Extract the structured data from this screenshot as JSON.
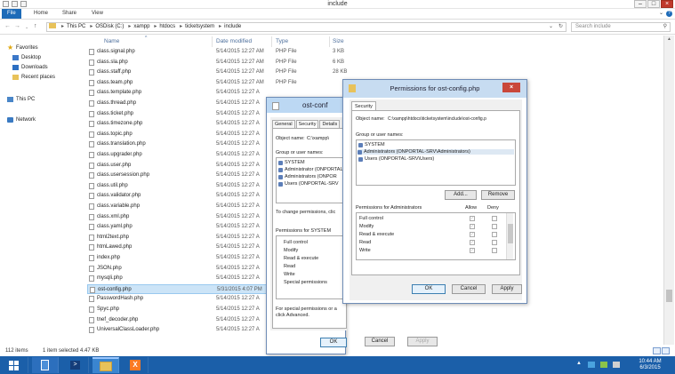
{
  "window": {
    "title": "include"
  },
  "ribbon": {
    "tabs": [
      "File",
      "Home",
      "Share",
      "View"
    ]
  },
  "address": {
    "crumbs": [
      "This PC",
      "OSDisk (C:)",
      "xampp",
      "htdocs",
      "ticketsystem",
      "include"
    ],
    "search_placeholder": "Search include"
  },
  "nav": {
    "favorites": "Favorites",
    "items": [
      "Desktop",
      "Downloads",
      "Recent places"
    ],
    "this_pc": "This PC",
    "network": "Network"
  },
  "columns": {
    "name": "Name",
    "date": "Date modified",
    "type": "Type",
    "size": "Size"
  },
  "files": [
    {
      "name": "class.signal.php",
      "date": "5/14/2015 12:27 AM",
      "type": "PHP File",
      "size": "3 KB"
    },
    {
      "name": "class.sla.php",
      "date": "5/14/2015 12:27 AM",
      "type": "PHP File",
      "size": "6 KB"
    },
    {
      "name": "class.staff.php",
      "date": "5/14/2015 12:27 AM",
      "type": "PHP File",
      "size": "28 KB"
    },
    {
      "name": "class.team.php",
      "date": "5/14/2015 12:27 AM",
      "type": "PHP File",
      "size": ""
    },
    {
      "name": "class.template.php",
      "date": "5/14/2015 12:27 A",
      "type": "",
      "size": ""
    },
    {
      "name": "class.thread.php",
      "date": "5/14/2015 12:27 A",
      "type": "",
      "size": ""
    },
    {
      "name": "class.ticket.php",
      "date": "5/14/2015 12:27 A",
      "type": "",
      "size": ""
    },
    {
      "name": "class.timezone.php",
      "date": "5/14/2015 12:27 A",
      "type": "",
      "size": ""
    },
    {
      "name": "class.topic.php",
      "date": "5/14/2015 12:27 A",
      "type": "",
      "size": ""
    },
    {
      "name": "class.translation.php",
      "date": "5/14/2015 12:27 A",
      "type": "",
      "size": ""
    },
    {
      "name": "class.upgrader.php",
      "date": "5/14/2015 12:27 A",
      "type": "",
      "size": ""
    },
    {
      "name": "class.user.php",
      "date": "5/14/2015 12:27 A",
      "type": "",
      "size": ""
    },
    {
      "name": "class.usersession.php",
      "date": "5/14/2015 12:27 A",
      "type": "",
      "size": ""
    },
    {
      "name": "class.util.php",
      "date": "5/14/2015 12:27 A",
      "type": "",
      "size": ""
    },
    {
      "name": "class.validator.php",
      "date": "5/14/2015 12:27 A",
      "type": "",
      "size": ""
    },
    {
      "name": "class.variable.php",
      "date": "5/14/2015 12:27 A",
      "type": "",
      "size": ""
    },
    {
      "name": "class.xml.php",
      "date": "5/14/2015 12:27 A",
      "type": "",
      "size": ""
    },
    {
      "name": "class.yaml.php",
      "date": "5/14/2015 12:27 A",
      "type": "",
      "size": ""
    },
    {
      "name": "html2text.php",
      "date": "5/14/2015 12:27 A",
      "type": "",
      "size": ""
    },
    {
      "name": "htmLawed.php",
      "date": "5/14/2015 12:27 A",
      "type": "",
      "size": ""
    },
    {
      "name": "index.php",
      "date": "5/14/2015 12:27 A",
      "type": "",
      "size": ""
    },
    {
      "name": "JSON.php",
      "date": "5/14/2015 12:27 A",
      "type": "",
      "size": ""
    },
    {
      "name": "mysqli.php",
      "date": "5/14/2015 12:27 A",
      "type": "",
      "size": ""
    },
    {
      "name": "ost-config.php",
      "date": "5/31/2015 4:07 PM",
      "type": "",
      "size": ""
    },
    {
      "name": "PasswordHash.php",
      "date": "5/14/2015 12:27 A",
      "type": "",
      "size": ""
    },
    {
      "name": "Spyc.php",
      "date": "5/14/2015 12:27 A",
      "type": "",
      "size": ""
    },
    {
      "name": "tnef_decoder.php",
      "date": "5/14/2015 12:27 A",
      "type": "",
      "size": ""
    },
    {
      "name": "UniversalClassLoader.php",
      "date": "5/14/2015 12:27 A",
      "type": "",
      "size": ""
    }
  ],
  "status": {
    "count": "112 items",
    "selected": "1 item selected  4.47 KB"
  },
  "props": {
    "title": "ost-conf",
    "tabs": [
      "General",
      "Security",
      "Details"
    ],
    "object_label": "Object name:",
    "object_value": "C:\\xampp\\",
    "group_label": "Group or user names:",
    "users": [
      "SYSTEM",
      "Administrator (ONPORTAL",
      "Administrators (ONPOR",
      "Users (ONPORTAL-SRV"
    ],
    "change_text": "To change permissions, clic",
    "perm_header": "Permissions for SYSTEM",
    "perms": [
      "Full control",
      "Modify",
      "Read & execute",
      "Read",
      "Write",
      "Special permissions"
    ],
    "special_text": "For special permissions or a",
    "special_text2": "click Advanced.",
    "ok": "OK",
    "cancel": "Cancel",
    "apply": "Apply"
  },
  "perm_dialog": {
    "title": "Permissions for ost-config.php",
    "tab": "Security",
    "object_label": "Object name:",
    "object_value": "C:\\xampp\\htdocs\\ticketsystem\\include\\ost-config.p",
    "group_label": "Group or user names:",
    "users": [
      "SYSTEM",
      "Administrators (ONPORTAL-SRV\\Administrators)",
      "Users (ONPORTAL-SRV\\Users)"
    ],
    "add": "Add...",
    "remove": "Remove",
    "perm_header": "Permissions for Administrators",
    "allow": "Allow",
    "deny": "Deny",
    "perms": [
      "Full control",
      "Modify",
      "Read & execute",
      "Read",
      "Write"
    ],
    "ok": "OK",
    "cancel": "Cancel",
    "apply": "Apply"
  },
  "tray": {
    "time": "10:44 AM",
    "date": "6/3/2015"
  }
}
